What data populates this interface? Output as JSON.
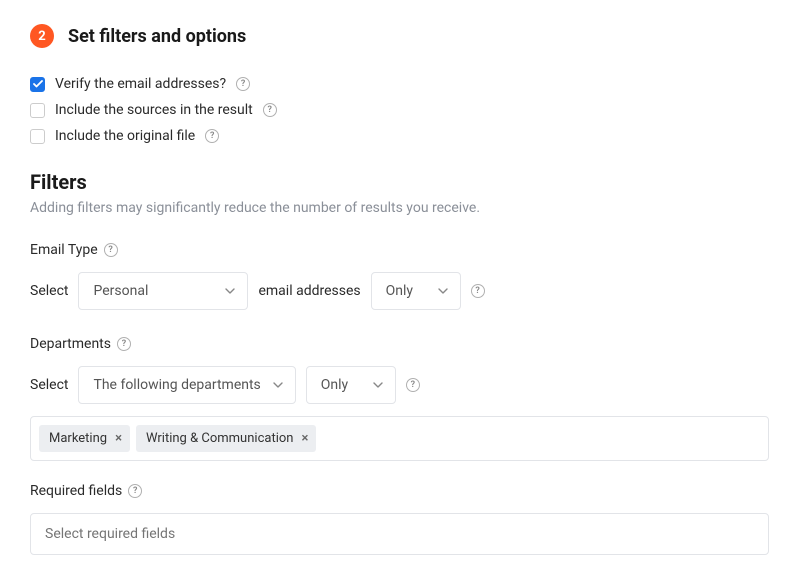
{
  "step": {
    "number": "2",
    "title": "Set filters and options"
  },
  "options": {
    "verify": {
      "label": "Verify the email addresses?",
      "checked": true
    },
    "include_sources": {
      "label": "Include the sources in the result",
      "checked": false
    },
    "include_original": {
      "label": "Include the original file",
      "checked": false
    }
  },
  "filters": {
    "heading": "Filters",
    "subtitle": "Adding filters may significantly reduce the number of results you receive."
  },
  "email_type": {
    "label": "Email Type",
    "select_prefix": "Select",
    "type_value": "Personal",
    "mid_text": "email addresses",
    "mode_value": "Only"
  },
  "departments": {
    "label": "Departments",
    "select_prefix": "Select",
    "dept_value": "The following departments",
    "mode_value": "Only",
    "tags": [
      "Marketing",
      "Writing & Communication"
    ]
  },
  "required_fields": {
    "label": "Required fields",
    "placeholder": "Select required fields"
  }
}
